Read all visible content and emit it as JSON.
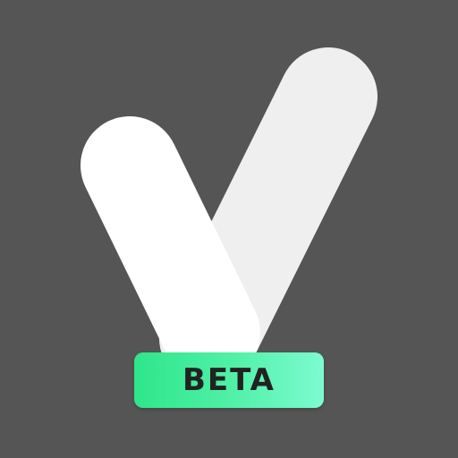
{
  "icon": {
    "badge_label": "BETA",
    "logo_glyph": "check-mark-v-logo",
    "colors": {
      "background": "#555556",
      "stroke_front": "#ffffff",
      "stroke_back": "#efefef",
      "badge_start": "#2ee68a",
      "badge_end": "#7dfbd1",
      "badge_text": "#222222"
    }
  }
}
